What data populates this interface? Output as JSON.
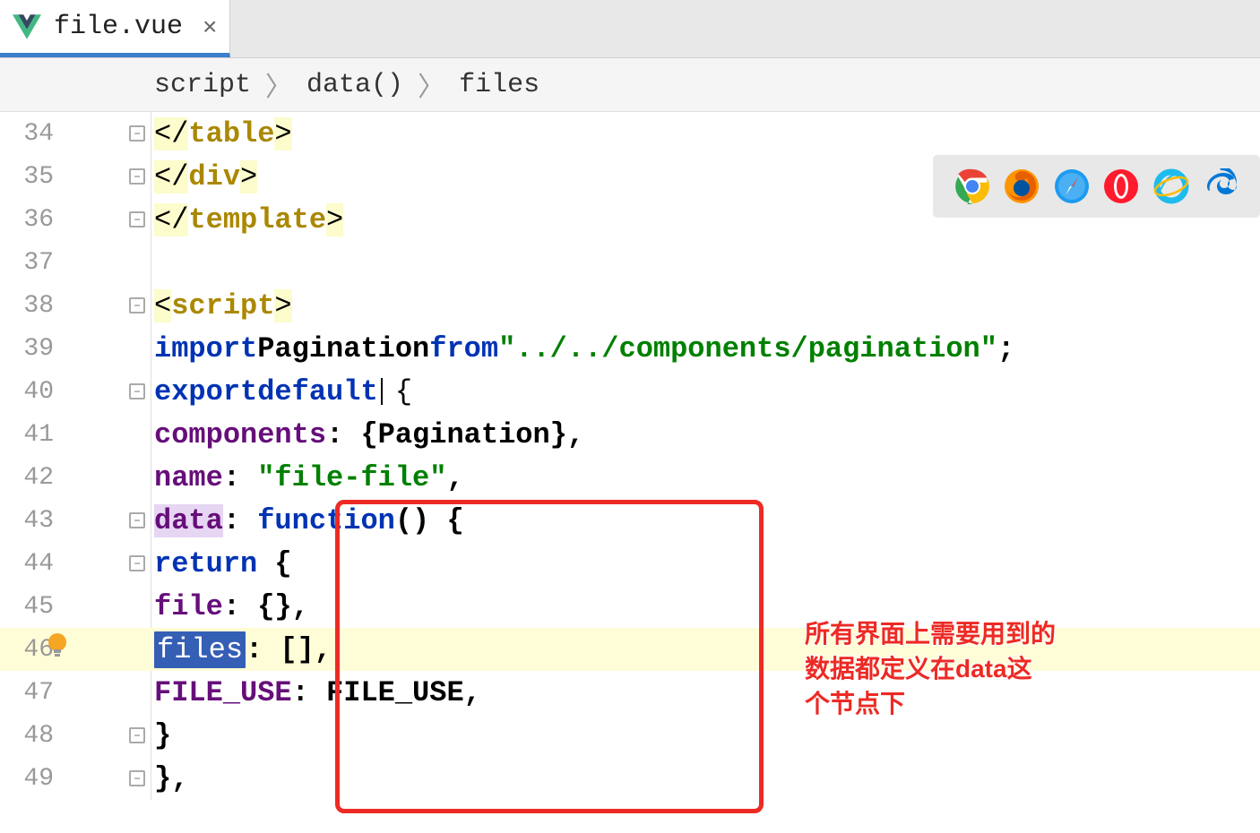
{
  "tab": {
    "filename": "file.vue"
  },
  "breadcrumbs": [
    "script",
    "data()",
    "files"
  ],
  "gutter": {
    "start": 34,
    "end": 49,
    "bulb_line": 46,
    "highlight_line": 46
  },
  "folds": [
    34,
    35,
    36,
    38,
    40,
    43,
    44,
    48,
    49
  ],
  "code": {
    "l34": {
      "close_tag": "table"
    },
    "l35": {
      "close_tag": "div"
    },
    "l36": {
      "close_tag": "template"
    },
    "l38": {
      "open_tag": "script"
    },
    "l39": {
      "kw_import": "import",
      "ident": "Pagination",
      "kw_from": "from",
      "path": "\"../../components/pagination\""
    },
    "l40": {
      "kw_export": "export",
      "kw_default": "default"
    },
    "l41": {
      "prop": "components",
      "val": "{Pagination},"
    },
    "l42": {
      "prop": "name",
      "val": "\"file-file\""
    },
    "l43": {
      "prop": "data",
      "kw_fn": "function"
    },
    "l44": {
      "kw_return": "return"
    },
    "l45": {
      "prop": "file",
      "val": "{},"
    },
    "l46": {
      "prop": "files",
      "val": "[],"
    },
    "l47": {
      "prop": "FILE_USE",
      "val": "FILE_USE,"
    }
  },
  "annotation": "所有界面上需要用到的\n数据都定义在data这\n个节点下",
  "browsers": [
    {
      "id": "chrome-icon"
    },
    {
      "id": "firefox-icon"
    },
    {
      "id": "safari-icon"
    },
    {
      "id": "opera-icon"
    },
    {
      "id": "ie-icon"
    },
    {
      "id": "edge-icon"
    }
  ]
}
